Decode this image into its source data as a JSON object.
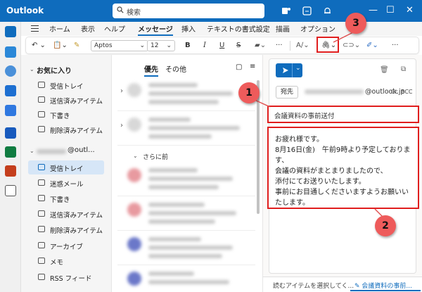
{
  "window": {
    "title": "Outlook",
    "search_placeholder": "検索"
  },
  "ribbon": {
    "tabs": [
      "ホーム",
      "表示",
      "ヘルプ",
      "メッセージ",
      "挿入",
      "テキストの書式設定",
      "描画",
      "オプション"
    ],
    "active_tab": "メッセージ",
    "font_name": "Aptos",
    "font_size": "12",
    "bold": "B",
    "italic": "I",
    "underline": "U",
    "strike": "S",
    "more": "···"
  },
  "folders": {
    "favorites_label": "お気に入り",
    "favorites": [
      "受信トレイ",
      "送信済みアイテム",
      "下書き",
      "削除済みアイテム"
    ],
    "account_suffix": "@outl...",
    "account_items": [
      "受信トレイ",
      "迷惑メール",
      "下書き",
      "送信済みアイテム",
      "削除済みアイテム",
      "アーカイブ",
      "メモ",
      "RSS フィード"
    ]
  },
  "message_list": {
    "tab_focused": "優先",
    "tab_other": "その他",
    "group_label": "さらに前"
  },
  "compose": {
    "to_button": "宛先",
    "to_domain": "@outlook.jp",
    "cc": "Cc",
    "bcc": "BCC",
    "subject": "会議資料の事前送付",
    "body_lines": [
      "お疲れ様です。",
      "8月16日(金)　午前9時より予定しておりま",
      "す、",
      "会議の資料がまとまりましたので、",
      "添付にてお送りいたします。",
      "事前にお目通しくださいますようお願いい",
      "たします。"
    ]
  },
  "callouts": [
    "1",
    "2",
    "3"
  ],
  "statusbar": {
    "left": "読むアイテムを選択してく...",
    "right": "会議資料の事前..."
  },
  "colors": {
    "accent": "#0f6cbd",
    "highlight": "#e01e1e",
    "callout": "#ee5b5b"
  }
}
